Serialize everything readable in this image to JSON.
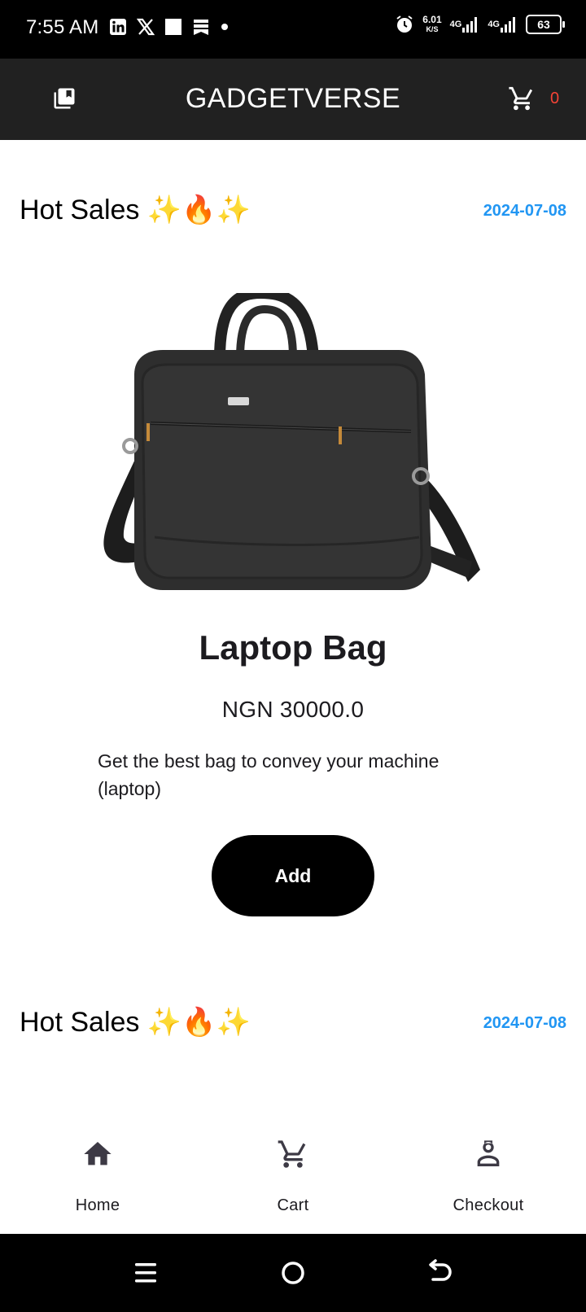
{
  "status_bar": {
    "time": "7:55 AM",
    "left_icons": [
      "linkedin-icon",
      "x-icon",
      "square-icon",
      "news-icon",
      "dot-icon"
    ],
    "net_speed_value": "6.01",
    "net_speed_unit": "K/S",
    "network_1": "4G",
    "network_2": "4G",
    "battery": "63"
  },
  "app_bar": {
    "title": "GADGETVERSE",
    "left_icon": "library-icon",
    "cart_icon": "cart-icon",
    "cart_count": "0"
  },
  "sections": [
    {
      "title": "Hot Sales ✨🔥✨",
      "date": "2024-07-08"
    },
    {
      "title": "Hot Sales ✨🔥✨",
      "date": "2024-07-08"
    }
  ],
  "product": {
    "name": "Laptop Bag",
    "price": "NGN 30000.0",
    "description": "Get the best bag to convey your machine (laptop)",
    "button_label": "Add",
    "image_icon": "laptop-bag-image"
  },
  "bottom_nav": {
    "items": [
      {
        "label": "Home",
        "icon": "home-icon"
      },
      {
        "label": "Cart",
        "icon": "cart-icon"
      },
      {
        "label": "Checkout",
        "icon": "checkout-icon"
      }
    ]
  },
  "colors": {
    "app_bar_bg": "#212121",
    "date_blue": "#2196f3",
    "cart_count_red": "#f44336",
    "button_bg": "#000000"
  }
}
